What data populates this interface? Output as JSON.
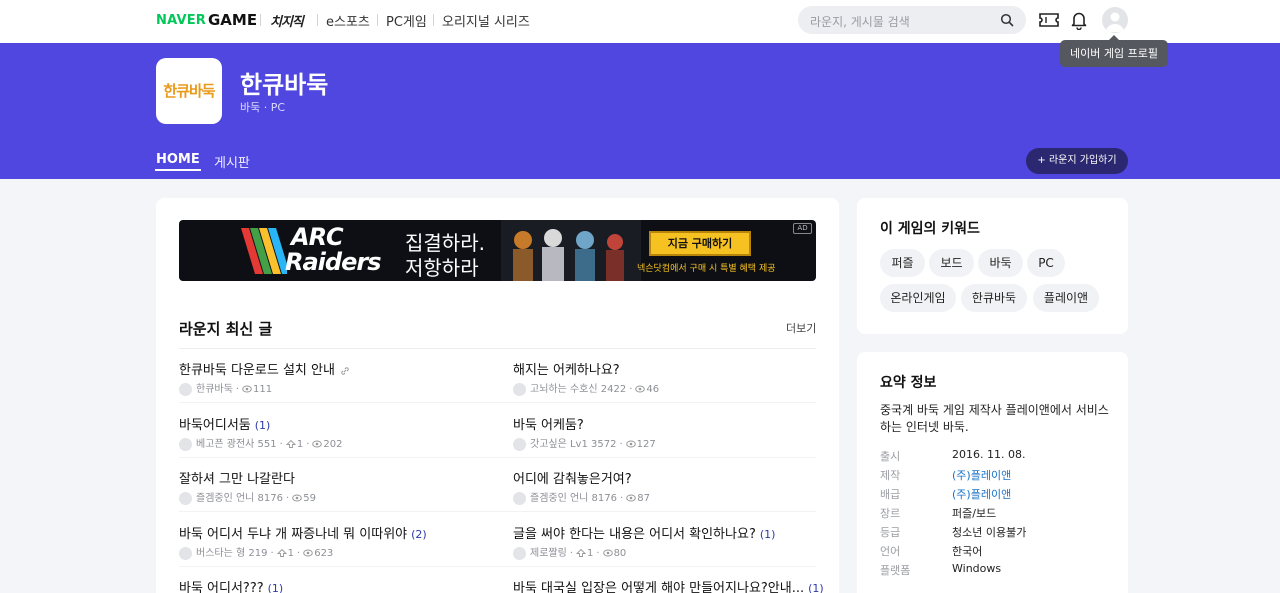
{
  "topnav": {
    "naver": "NAVER",
    "game": "GAME",
    "items": [
      {
        "label": "치지직"
      },
      {
        "label": "e스포츠"
      },
      {
        "label": "PC게임"
      },
      {
        "label": "오리지널 시리즈"
      }
    ],
    "search_placeholder": "라운지, 게시물 검색",
    "tooltip": "네이버 게임 프로필"
  },
  "hero": {
    "logo_text": "한큐바둑",
    "title": "한큐바둑",
    "subtitle": "바둑 · PC",
    "tabs": [
      {
        "label": "HOME"
      },
      {
        "label": "게시판"
      }
    ],
    "join_button": "+ 라운지 가입하기"
  },
  "ad": {
    "brand_line1": "ARC",
    "brand_line2": "Raiders",
    "slogan1": "집결하라.",
    "slogan2": "저항하라",
    "button": "지금 구매하기",
    "note": "넥슨닷컴에서 구매 시 특별 혜택 제공",
    "badge": "AD"
  },
  "latest": {
    "title": "라운지 최신 글",
    "more": "더보기",
    "posts": [
      {
        "title": "한큐바둑 다운로드 설치 안내",
        "count": "",
        "author": "한큐바둑",
        "likes": "",
        "views": "111"
      },
      {
        "title": "해지는 어케하나요?",
        "count": "",
        "author": "고뇌하는 수호신 2422",
        "likes": "",
        "views": "46"
      },
      {
        "title": "바둑어디서둠",
        "count": "(1)",
        "author": "베고픈 광전사 551",
        "likes": "1",
        "views": "202"
      },
      {
        "title": "바둑 어케둠?",
        "count": "",
        "author": "갓고싶은 Lv1 3572",
        "likes": "",
        "views": "127"
      },
      {
        "title": "잘하셔 그만 나갈란다",
        "count": "",
        "author": "즐겜중인 언니 8176",
        "likes": "",
        "views": "59"
      },
      {
        "title": "어디에 감춰놓은거여?",
        "count": "",
        "author": "즐겜중인 언니 8176",
        "likes": "",
        "views": "87"
      },
      {
        "title": "바둑 어디서 두냐 개 짜증나네 뭐 이따위야",
        "count": "(2)",
        "author": "버스타는 형 219",
        "likes": "1",
        "views": "623"
      },
      {
        "title": "글을 써야 한다는 내용은 어디서 확인하나요?",
        "count": "(1)",
        "author": "제로짤링",
        "likes": "1",
        "views": "80"
      },
      {
        "title": "바둑 어디서???",
        "count": "(1)",
        "author": "",
        "likes": "",
        "views": ""
      },
      {
        "title": "바둑 대국실 입장은 어떻게 해야 만들어지나요?안내...",
        "count": "(1)",
        "author": "",
        "likes": "",
        "views": ""
      }
    ]
  },
  "keywords": {
    "title": "이 게임의 키워드",
    "chips": [
      "퍼즐",
      "보드",
      "바둑",
      "PC",
      "온라인게임",
      "한큐바둑",
      "플레이앤"
    ]
  },
  "summary": {
    "title": "요약 정보",
    "description": "중국계 바둑 게임 제작사 플레이앤에서 서비스하는 인터넷 바둑.",
    "rows": [
      {
        "key": "출시",
        "value": "2016. 11. 08."
      },
      {
        "key": "제작",
        "value": "(주)플레이앤"
      },
      {
        "key": "배급",
        "value": "(주)플레이앤"
      },
      {
        "key": "장르",
        "value": "퍼즐/보드"
      },
      {
        "key": "등급",
        "value": "청소년 이용불가"
      },
      {
        "key": "언어",
        "value": "한국어"
      },
      {
        "key": "플랫폼",
        "value": "Windows"
      }
    ]
  },
  "colors": {
    "hero": "#5047e0",
    "naver_green": "#03c75a",
    "link": "#1a73c8"
  }
}
